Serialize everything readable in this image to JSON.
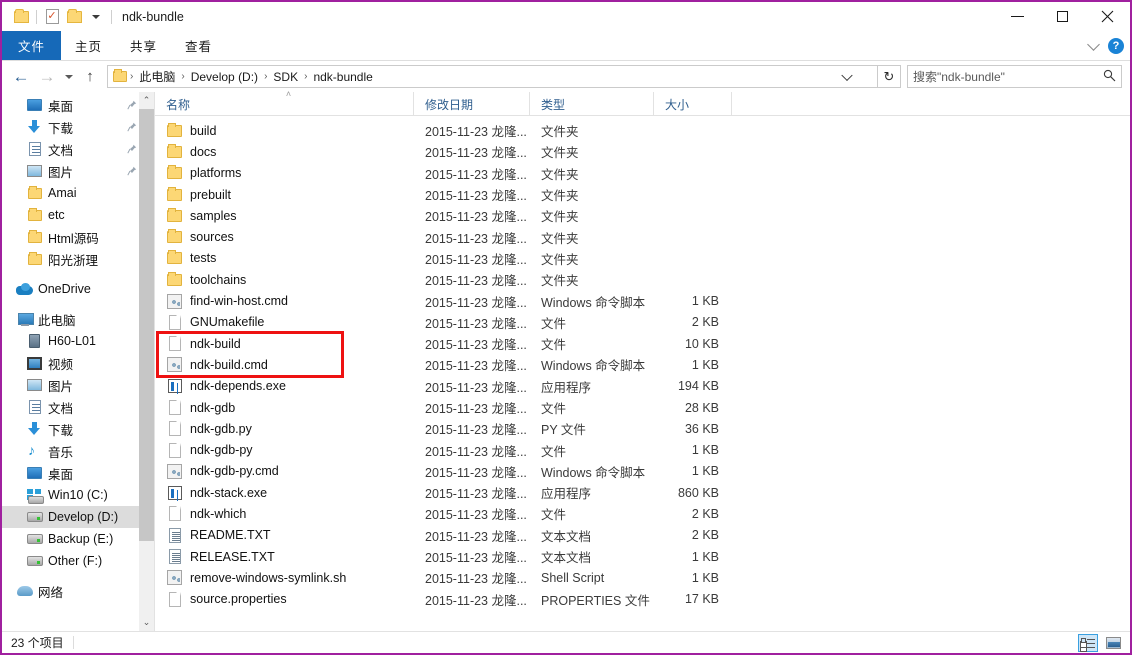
{
  "window": {
    "title": "ndk-bundle",
    "border_color": "#a0209f",
    "quick_access": [
      {
        "name": "folder-icon",
        "label": "folder"
      },
      {
        "name": "properties-icon",
        "label": "properties"
      },
      {
        "name": "new-folder-icon",
        "label": "new folder"
      },
      {
        "name": "customize-qat-caret",
        "label": "customize"
      }
    ],
    "controls": {
      "minimize": "–",
      "maximize": "□",
      "close": "✕"
    }
  },
  "ribbon": {
    "tabs": [
      {
        "label": "文件",
        "active": true
      },
      {
        "label": "主页",
        "active": false
      },
      {
        "label": "共享",
        "active": false
      },
      {
        "label": "查看",
        "active": false
      }
    ],
    "accent_color": "#1669b8",
    "collapse_label": "∨",
    "help_label": "?"
  },
  "addressbar": {
    "back": "←",
    "forward": "→",
    "recent_label": "▾",
    "up": "↑",
    "breadcrumbs": [
      "此电脑",
      "Develop (D:)",
      "SDK",
      "ndk-bundle"
    ],
    "separator": "›",
    "refresh": "↻",
    "search_placeholder": "搜索\"ndk-bundle\"",
    "search_value": "",
    "search_icon": "⌕"
  },
  "sidebar": {
    "items": [
      {
        "label": "桌面",
        "icon": "desktop-icon",
        "level": 1,
        "pinned": true,
        "selected": false
      },
      {
        "label": "下载",
        "icon": "download-icon",
        "level": 1,
        "pinned": true,
        "selected": false
      },
      {
        "label": "文档",
        "icon": "documents-icon",
        "level": 1,
        "pinned": true,
        "selected": false
      },
      {
        "label": "图片",
        "icon": "pictures-icon",
        "level": 1,
        "pinned": true,
        "selected": false
      },
      {
        "label": "Amai",
        "icon": "folder-icon",
        "level": 1,
        "pinned": false,
        "selected": false
      },
      {
        "label": "etc",
        "icon": "folder-icon",
        "level": 1,
        "pinned": false,
        "selected": false
      },
      {
        "label": "Html源码",
        "icon": "folder-icon",
        "level": 1,
        "pinned": false,
        "selected": false
      },
      {
        "label": "阳光浙理",
        "icon": "folder-icon",
        "level": 1,
        "pinned": false,
        "selected": false
      },
      {
        "label": "OneDrive",
        "icon": "onedrive-icon",
        "level": 0,
        "pinned": false,
        "selected": false,
        "gap_before": true
      },
      {
        "label": "此电脑",
        "icon": "this-pc-icon",
        "level": 0,
        "pinned": false,
        "selected": false,
        "gap_before": true
      },
      {
        "label": "H60-L01",
        "icon": "phone-icon",
        "level": 1,
        "pinned": false,
        "selected": false
      },
      {
        "label": "视频",
        "icon": "videos-icon",
        "level": 1,
        "pinned": false,
        "selected": false
      },
      {
        "label": "图片",
        "icon": "pictures-icon",
        "level": 1,
        "pinned": false,
        "selected": false
      },
      {
        "label": "文档",
        "icon": "documents-icon",
        "level": 1,
        "pinned": false,
        "selected": false
      },
      {
        "label": "下载",
        "icon": "download-icon",
        "level": 1,
        "pinned": false,
        "selected": false
      },
      {
        "label": "音乐",
        "icon": "music-icon",
        "level": 1,
        "pinned": false,
        "selected": false
      },
      {
        "label": "桌面",
        "icon": "desktop-icon",
        "level": 1,
        "pinned": false,
        "selected": false
      },
      {
        "label": "Win10 (C:)",
        "icon": "windows-drive-icon",
        "level": 1,
        "pinned": false,
        "selected": false
      },
      {
        "label": "Develop (D:)",
        "icon": "drive-icon",
        "level": 1,
        "pinned": false,
        "selected": true
      },
      {
        "label": "Backup (E:)",
        "icon": "drive-icon",
        "level": 1,
        "pinned": false,
        "selected": false
      },
      {
        "label": "Other (F:)",
        "icon": "drive-icon",
        "level": 1,
        "pinned": false,
        "selected": false
      },
      {
        "label": "网络",
        "icon": "network-icon",
        "level": 0,
        "pinned": false,
        "selected": false,
        "gap_before": true
      }
    ],
    "scroll_up": "⌃",
    "scroll_down": "⌄"
  },
  "filelist": {
    "columns": [
      {
        "label": "名称",
        "sorted": true,
        "sort_dir": "asc"
      },
      {
        "label": "修改日期",
        "sorted": false
      },
      {
        "label": "类型",
        "sorted": false
      },
      {
        "label": "大小",
        "sorted": false
      }
    ],
    "sort_glyph": "˄",
    "rows": [
      {
        "name": "build",
        "icon": "folder-icon",
        "date": "2015-11-23 龙隆...",
        "type": "文件夹",
        "size": ""
      },
      {
        "name": "docs",
        "icon": "folder-icon",
        "date": "2015-11-23 龙隆...",
        "type": "文件夹",
        "size": ""
      },
      {
        "name": "platforms",
        "icon": "folder-icon",
        "date": "2015-11-23 龙隆...",
        "type": "文件夹",
        "size": ""
      },
      {
        "name": "prebuilt",
        "icon": "folder-icon",
        "date": "2015-11-23 龙隆...",
        "type": "文件夹",
        "size": ""
      },
      {
        "name": "samples",
        "icon": "folder-icon",
        "date": "2015-11-23 龙隆...",
        "type": "文件夹",
        "size": ""
      },
      {
        "name": "sources",
        "icon": "folder-icon",
        "date": "2015-11-23 龙隆...",
        "type": "文件夹",
        "size": ""
      },
      {
        "name": "tests",
        "icon": "folder-icon",
        "date": "2015-11-23 龙隆...",
        "type": "文件夹",
        "size": ""
      },
      {
        "name": "toolchains",
        "icon": "folder-icon",
        "date": "2015-11-23 龙隆...",
        "type": "文件夹",
        "size": ""
      },
      {
        "name": "find-win-host.cmd",
        "icon": "cmd-icon",
        "date": "2015-11-23 龙隆...",
        "type": "Windows 命令脚本",
        "size": "1 KB"
      },
      {
        "name": "GNUmakefile",
        "icon": "blank-file-icon",
        "date": "2015-11-23 龙隆...",
        "type": "文件",
        "size": "2 KB"
      },
      {
        "name": "ndk-build",
        "icon": "blank-file-icon",
        "date": "2015-11-23 龙隆...",
        "type": "文件",
        "size": "10 KB"
      },
      {
        "name": "ndk-build.cmd",
        "icon": "cmd-icon",
        "date": "2015-11-23 龙隆...",
        "type": "Windows 命令脚本",
        "size": "1 KB"
      },
      {
        "name": "ndk-depends.exe",
        "icon": "exe-icon",
        "date": "2015-11-23 龙隆...",
        "type": "应用程序",
        "size": "194 KB"
      },
      {
        "name": "ndk-gdb",
        "icon": "blank-file-icon",
        "date": "2015-11-23 龙隆...",
        "type": "文件",
        "size": "28 KB"
      },
      {
        "name": "ndk-gdb.py",
        "icon": "blank-file-icon",
        "date": "2015-11-23 龙隆...",
        "type": "PY 文件",
        "size": "36 KB"
      },
      {
        "name": "ndk-gdb-py",
        "icon": "blank-file-icon",
        "date": "2015-11-23 龙隆...",
        "type": "文件",
        "size": "1 KB"
      },
      {
        "name": "ndk-gdb-py.cmd",
        "icon": "cmd-icon",
        "date": "2015-11-23 龙隆...",
        "type": "Windows 命令脚本",
        "size": "1 KB"
      },
      {
        "name": "ndk-stack.exe",
        "icon": "exe-icon",
        "date": "2015-11-23 龙隆...",
        "type": "应用程序",
        "size": "860 KB"
      },
      {
        "name": "ndk-which",
        "icon": "blank-file-icon",
        "date": "2015-11-23 龙隆...",
        "type": "文件",
        "size": "2 KB"
      },
      {
        "name": "README.TXT",
        "icon": "text-file-icon",
        "date": "2015-11-23 龙隆...",
        "type": "文本文档",
        "size": "2 KB"
      },
      {
        "name": "RELEASE.TXT",
        "icon": "text-file-icon",
        "date": "2015-11-23 龙隆...",
        "type": "文本文档",
        "size": "1 KB"
      },
      {
        "name": "remove-windows-symlink.sh",
        "icon": "cmd-icon",
        "date": "2015-11-23 龙隆...",
        "type": "Shell Script",
        "size": "1 KB"
      },
      {
        "name": "source.properties",
        "icon": "blank-file-icon",
        "date": "2015-11-23 龙隆...",
        "type": "PROPERTIES 文件",
        "size": "17 KB"
      }
    ],
    "highlight": {
      "color": "#ee1111",
      "rows": [
        "ndk-build",
        "ndk-build.cmd"
      ]
    }
  },
  "statusbar": {
    "item_count": "23 个项目",
    "views": [
      {
        "name": "details-view-button",
        "active": true
      },
      {
        "name": "large-icons-view-button",
        "active": false
      }
    ]
  }
}
